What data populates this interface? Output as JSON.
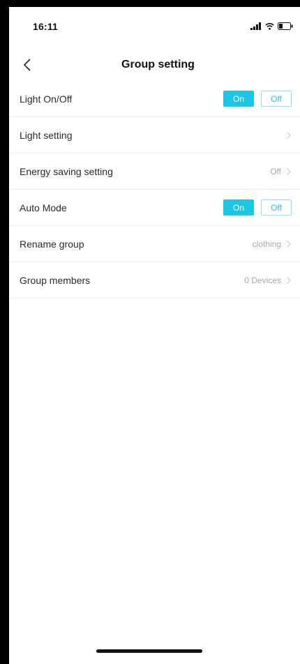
{
  "status_bar": {
    "time": "16:11",
    "icons": [
      "signal-icon",
      "wifi-icon",
      "battery-icon"
    ]
  },
  "nav": {
    "back_icon": "chevron-left-icon",
    "title": "Group setting"
  },
  "settings": {
    "light_onoff": {
      "label": "Light On/Off",
      "on_label": "On",
      "off_label": "Off",
      "selected": "On"
    },
    "light_setting": {
      "label": "Light setting",
      "value": ""
    },
    "energy_saving": {
      "label": "Energy saving setting",
      "value": "Off"
    },
    "auto_mode": {
      "label": "Auto Mode",
      "on_label": "On",
      "off_label": "Off",
      "selected": "On"
    },
    "rename_group": {
      "label": "Rename group",
      "value": "clothing"
    },
    "group_members": {
      "label": "Group members",
      "value": "0 Devices"
    }
  },
  "colors": {
    "accent": "#1ec6e6",
    "divider": "#ececec",
    "value_text": "#a8a8a8"
  }
}
